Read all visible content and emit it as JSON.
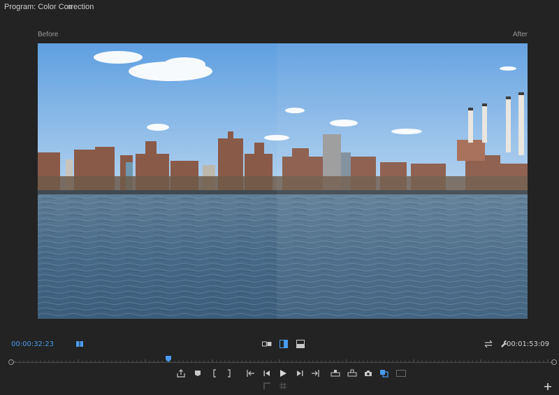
{
  "panel": {
    "title": "Program: Color Correction",
    "menu_glyph": "≡"
  },
  "viewer": {
    "before_label": "Before",
    "after_label": "After"
  },
  "timecode": {
    "current": "00:00:32:23",
    "duration": "00:01:53:09"
  },
  "playhead_position": 0.29,
  "colors": {
    "accent": "#4a9bf0",
    "background": "#232323",
    "icon": "#c8c8c8"
  },
  "icons": {
    "marker_indicator": "in-out-marker-icon",
    "view_modes": [
      "side-by-side-view-icon",
      "split-view-icon",
      "horizontal-split-view-icon"
    ],
    "settings": [
      "swap-sides-icon",
      "wrench-icon"
    ],
    "transport": [
      "export-frame-icon",
      "add-marker-icon",
      "mark-in-icon",
      "mark-out-icon",
      "go-to-in-icon",
      "step-back-icon",
      "play-icon",
      "step-forward-icon",
      "go-to-out-icon",
      "lift-icon",
      "extract-icon",
      "camera-icon",
      "comparison-view-icon",
      "safe-margins-icon"
    ],
    "secondary": [
      "trim-icon",
      "grid-icon"
    ],
    "add_button": "plus-icon"
  }
}
